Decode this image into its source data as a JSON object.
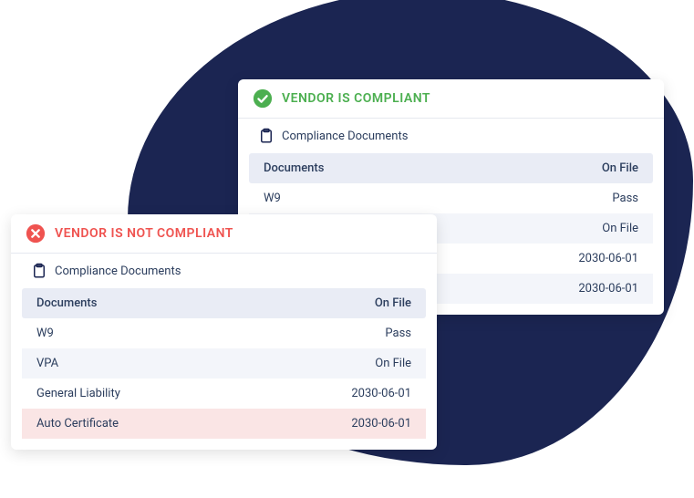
{
  "colors": {
    "background_blob": "#1b2552",
    "compliant": "#4caf50",
    "noncompliant": "#ef5350",
    "row_header_bg": "#e9ecf5",
    "row_alt_bg": "#f3f5fa",
    "row_highlight_bg": "#fae5e5"
  },
  "cards": {
    "compliant": {
      "status": "VENDOR IS COMPLIANT",
      "section_title": "Compliance Documents",
      "header": {
        "label": "Documents",
        "value": "On File"
      },
      "rows": [
        {
          "label": "W9",
          "value": "Pass"
        },
        {
          "label": "",
          "value": "On File"
        },
        {
          "label": "",
          "value": "2030-06-01"
        },
        {
          "label": "",
          "value": "2030-06-01"
        }
      ]
    },
    "noncompliant": {
      "status": "VENDOR IS NOT COMPLIANT",
      "section_title": "Compliance Documents",
      "header": {
        "label": "Documents",
        "value": "On File"
      },
      "rows": [
        {
          "label": "W9",
          "value": "Pass"
        },
        {
          "label": "VPA",
          "value": "On File"
        },
        {
          "label": "General Liability",
          "value": "2030-06-01"
        },
        {
          "label": "Auto Certificate",
          "value": "2030-06-01"
        }
      ]
    }
  }
}
